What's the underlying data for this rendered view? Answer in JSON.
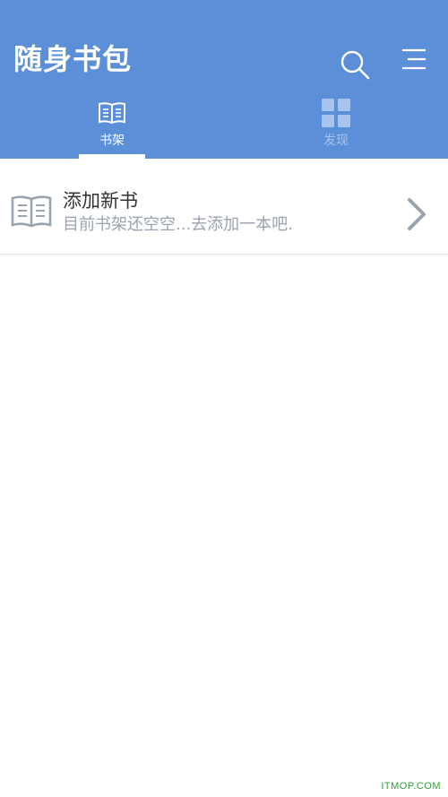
{
  "header": {
    "title": "随身书包",
    "search_icon": "search-icon",
    "menu_icon": "menu-icon",
    "background_color": "#5b8fd8"
  },
  "tabs": [
    {
      "label": "书架",
      "icon": "open-book-icon",
      "active": true
    },
    {
      "label": "发现",
      "icon": "grid-icon",
      "active": false
    }
  ],
  "list": {
    "items": [
      {
        "icon": "open-book-icon",
        "title": "添加新书",
        "subtitle": "目前书架还空空...去添加一本吧.",
        "chevron": "chevron-right-icon"
      }
    ]
  },
  "watermark": "ITMOP.COM"
}
